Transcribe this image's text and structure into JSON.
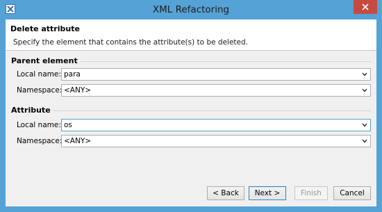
{
  "window": {
    "title": "XML Refactoring"
  },
  "header": {
    "title": "Delete attribute",
    "description": "Specify the element that contains the attribute(s) to be deleted."
  },
  "parent_element": {
    "title": "Parent element",
    "local_name": {
      "label": "Local name:",
      "value": "para"
    },
    "namespace": {
      "label": "Namespace:",
      "value": "<ANY>"
    }
  },
  "attribute": {
    "title": "Attribute",
    "local_name": {
      "label": "Local name:",
      "value": "os"
    },
    "namespace": {
      "label": "Namespace:",
      "value": "<ANY>"
    }
  },
  "buttons": {
    "back": "< Back",
    "next": "Next >",
    "finish": "Finish",
    "cancel": "Cancel"
  }
}
